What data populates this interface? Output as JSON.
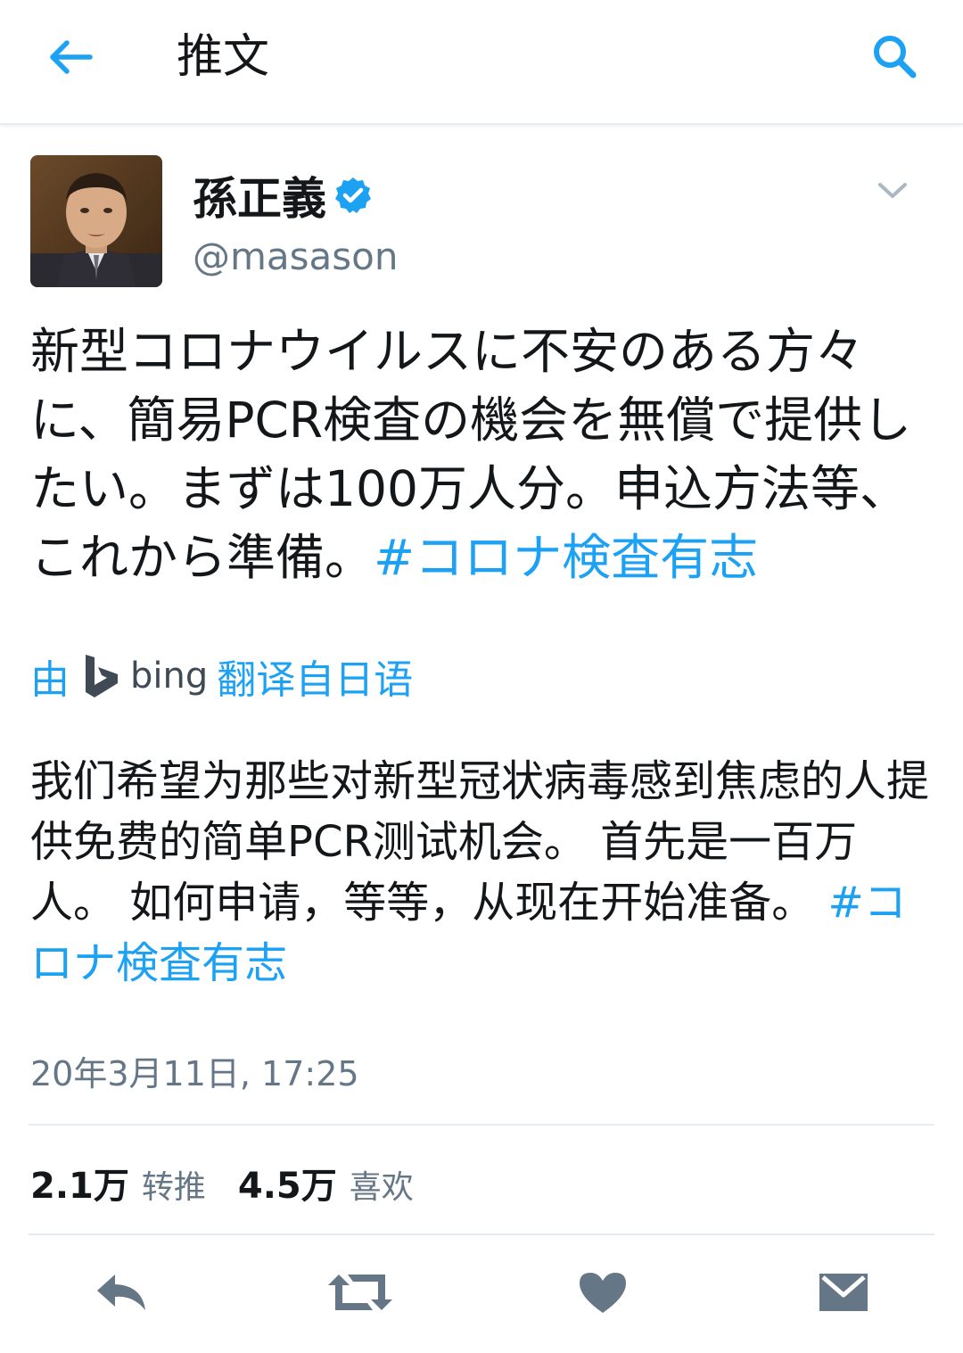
{
  "header": {
    "title": "推文",
    "back_icon": "arrow-left-icon",
    "search_icon": "search-icon",
    "accent_color": "#1da1f2"
  },
  "author": {
    "name": "孫正義",
    "handle": "@masason",
    "verified": true
  },
  "tweet": {
    "text": "新型コロナウイルスに不安のある方々に、簡易PCR検査の機会を無償で提供したい。まずは100万人分。申込方法等、これから準備。",
    "hashtag": "#コロナ検査有志"
  },
  "translation": {
    "prefix": "由",
    "provider": "bing",
    "suffix": "翻译自日语",
    "text": "我们希望为那些对新型冠状病毒感到焦虑的人提供免费的简单PCR测试机会。 首先是一百万人。 如何申请，等等，从现在开始准备。",
    "hashtag": "#コロナ検査有志"
  },
  "timestamp": "20年3月11日, 17:25",
  "stats": {
    "retweets_count": "2.1万",
    "retweets_label": "转推",
    "likes_count": "4.5万",
    "likes_label": "喜欢"
  },
  "actions": [
    "reply-icon",
    "retweet-icon",
    "heart-icon",
    "message-icon"
  ]
}
